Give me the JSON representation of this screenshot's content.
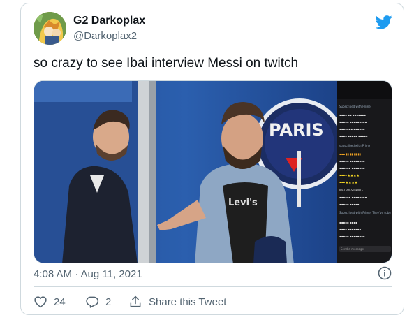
{
  "tweet": {
    "author_name": "G2 Darkoplax",
    "author_handle": "@Darkoplax2",
    "text": "so crazy to see Ibai interview Messi on twitch",
    "timestamp": "4:08 AM · Aug 11, 2021"
  },
  "actions": {
    "like_count": "24",
    "reply_count": "2",
    "share_label": "Share this Tweet"
  },
  "media": {
    "scene_sign_text": "PARIS",
    "shirt_text": "Levi's",
    "chat_lines": [
      "Subscribed with Prime",
      "subscribed with Prime",
      "IBAI PRESIDENTE",
      "Subscribed with Prime. They've subscribed for 2 months!",
      "Send a message"
    ]
  },
  "colors": {
    "brand": "#1d9bf0",
    "text_secondary": "#536471",
    "border": "#cfd9de"
  },
  "icons": {
    "logo": "twitter-bird-icon",
    "info": "info-icon",
    "like": "heart-icon",
    "reply": "reply-icon",
    "share": "share-icon"
  }
}
